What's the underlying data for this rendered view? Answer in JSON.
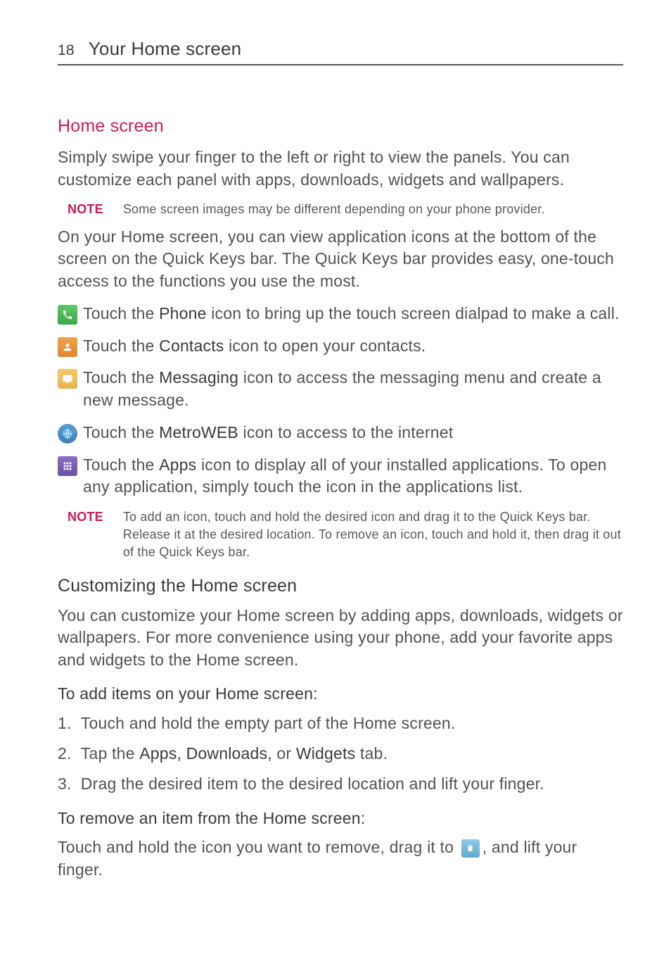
{
  "page_number": "18",
  "header_title": "Your Home screen",
  "section": {
    "heading": "Home screen",
    "intro": "Simply swipe your finger to the left or right to view the panels. You can customize each panel with apps, downloads, widgets and wallpapers.",
    "note1_label": "NOTE",
    "note1_text": "Some screen images may be different depending on your phone provider.",
    "quickkeys_intro": "On your Home screen, you can view application icons at the bottom of the screen on the Quick Keys bar. The Quick Keys bar provides easy, one-touch access to the functions you use the most.",
    "items": [
      {
        "pre": "Touch the ",
        "strong": "Phone",
        "post": " icon to bring up the touch screen dialpad to make a call."
      },
      {
        "pre": "Touch the ",
        "strong": "Contacts",
        "post": " icon to open your contacts."
      },
      {
        "pre": "Touch the ",
        "strong": "Messaging",
        "post": " icon to access the messaging menu and create a new message."
      },
      {
        "pre": "Touch the ",
        "strong": "MetroWEB",
        "post": " icon to access to the internet"
      },
      {
        "pre": "Touch the ",
        "strong": "Apps",
        "post": " icon to display all of your installed applications. To open any application, simply touch the icon in the applications list."
      }
    ],
    "note2_label": "NOTE",
    "note2_text": "To add an icon, touch and hold the desired icon and drag it to the Quick Keys bar. Release it at the desired location. To remove an icon, touch and hold it, then drag it out of the Quick Keys bar."
  },
  "customizing": {
    "heading": "Customizing the Home screen",
    "intro": "You can customize your Home screen by adding apps, downloads, widgets or wallpapers. For more convenience using your phone, add your favorite apps and widgets to the Home screen.",
    "add_heading": "To add items on your Home screen:",
    "steps": [
      {
        "num": "1.",
        "pre": "Touch and hold the empty part of the Home screen.",
        "strong": "",
        "post": ""
      },
      {
        "num": "2.",
        "pre": "Tap the ",
        "strong": "Apps, Downloads,",
        "mid": " or ",
        "strong2": "Widgets",
        "post": " tab."
      },
      {
        "num": "3.",
        "pre": "Drag the desired item to the desired location and lift your finger.",
        "strong": "",
        "post": ""
      }
    ],
    "remove_heading": "To remove an item from the Home screen:",
    "remove_pre": "Touch and hold the icon you want to remove, drag it to ",
    "remove_post": ", and lift your finger."
  }
}
